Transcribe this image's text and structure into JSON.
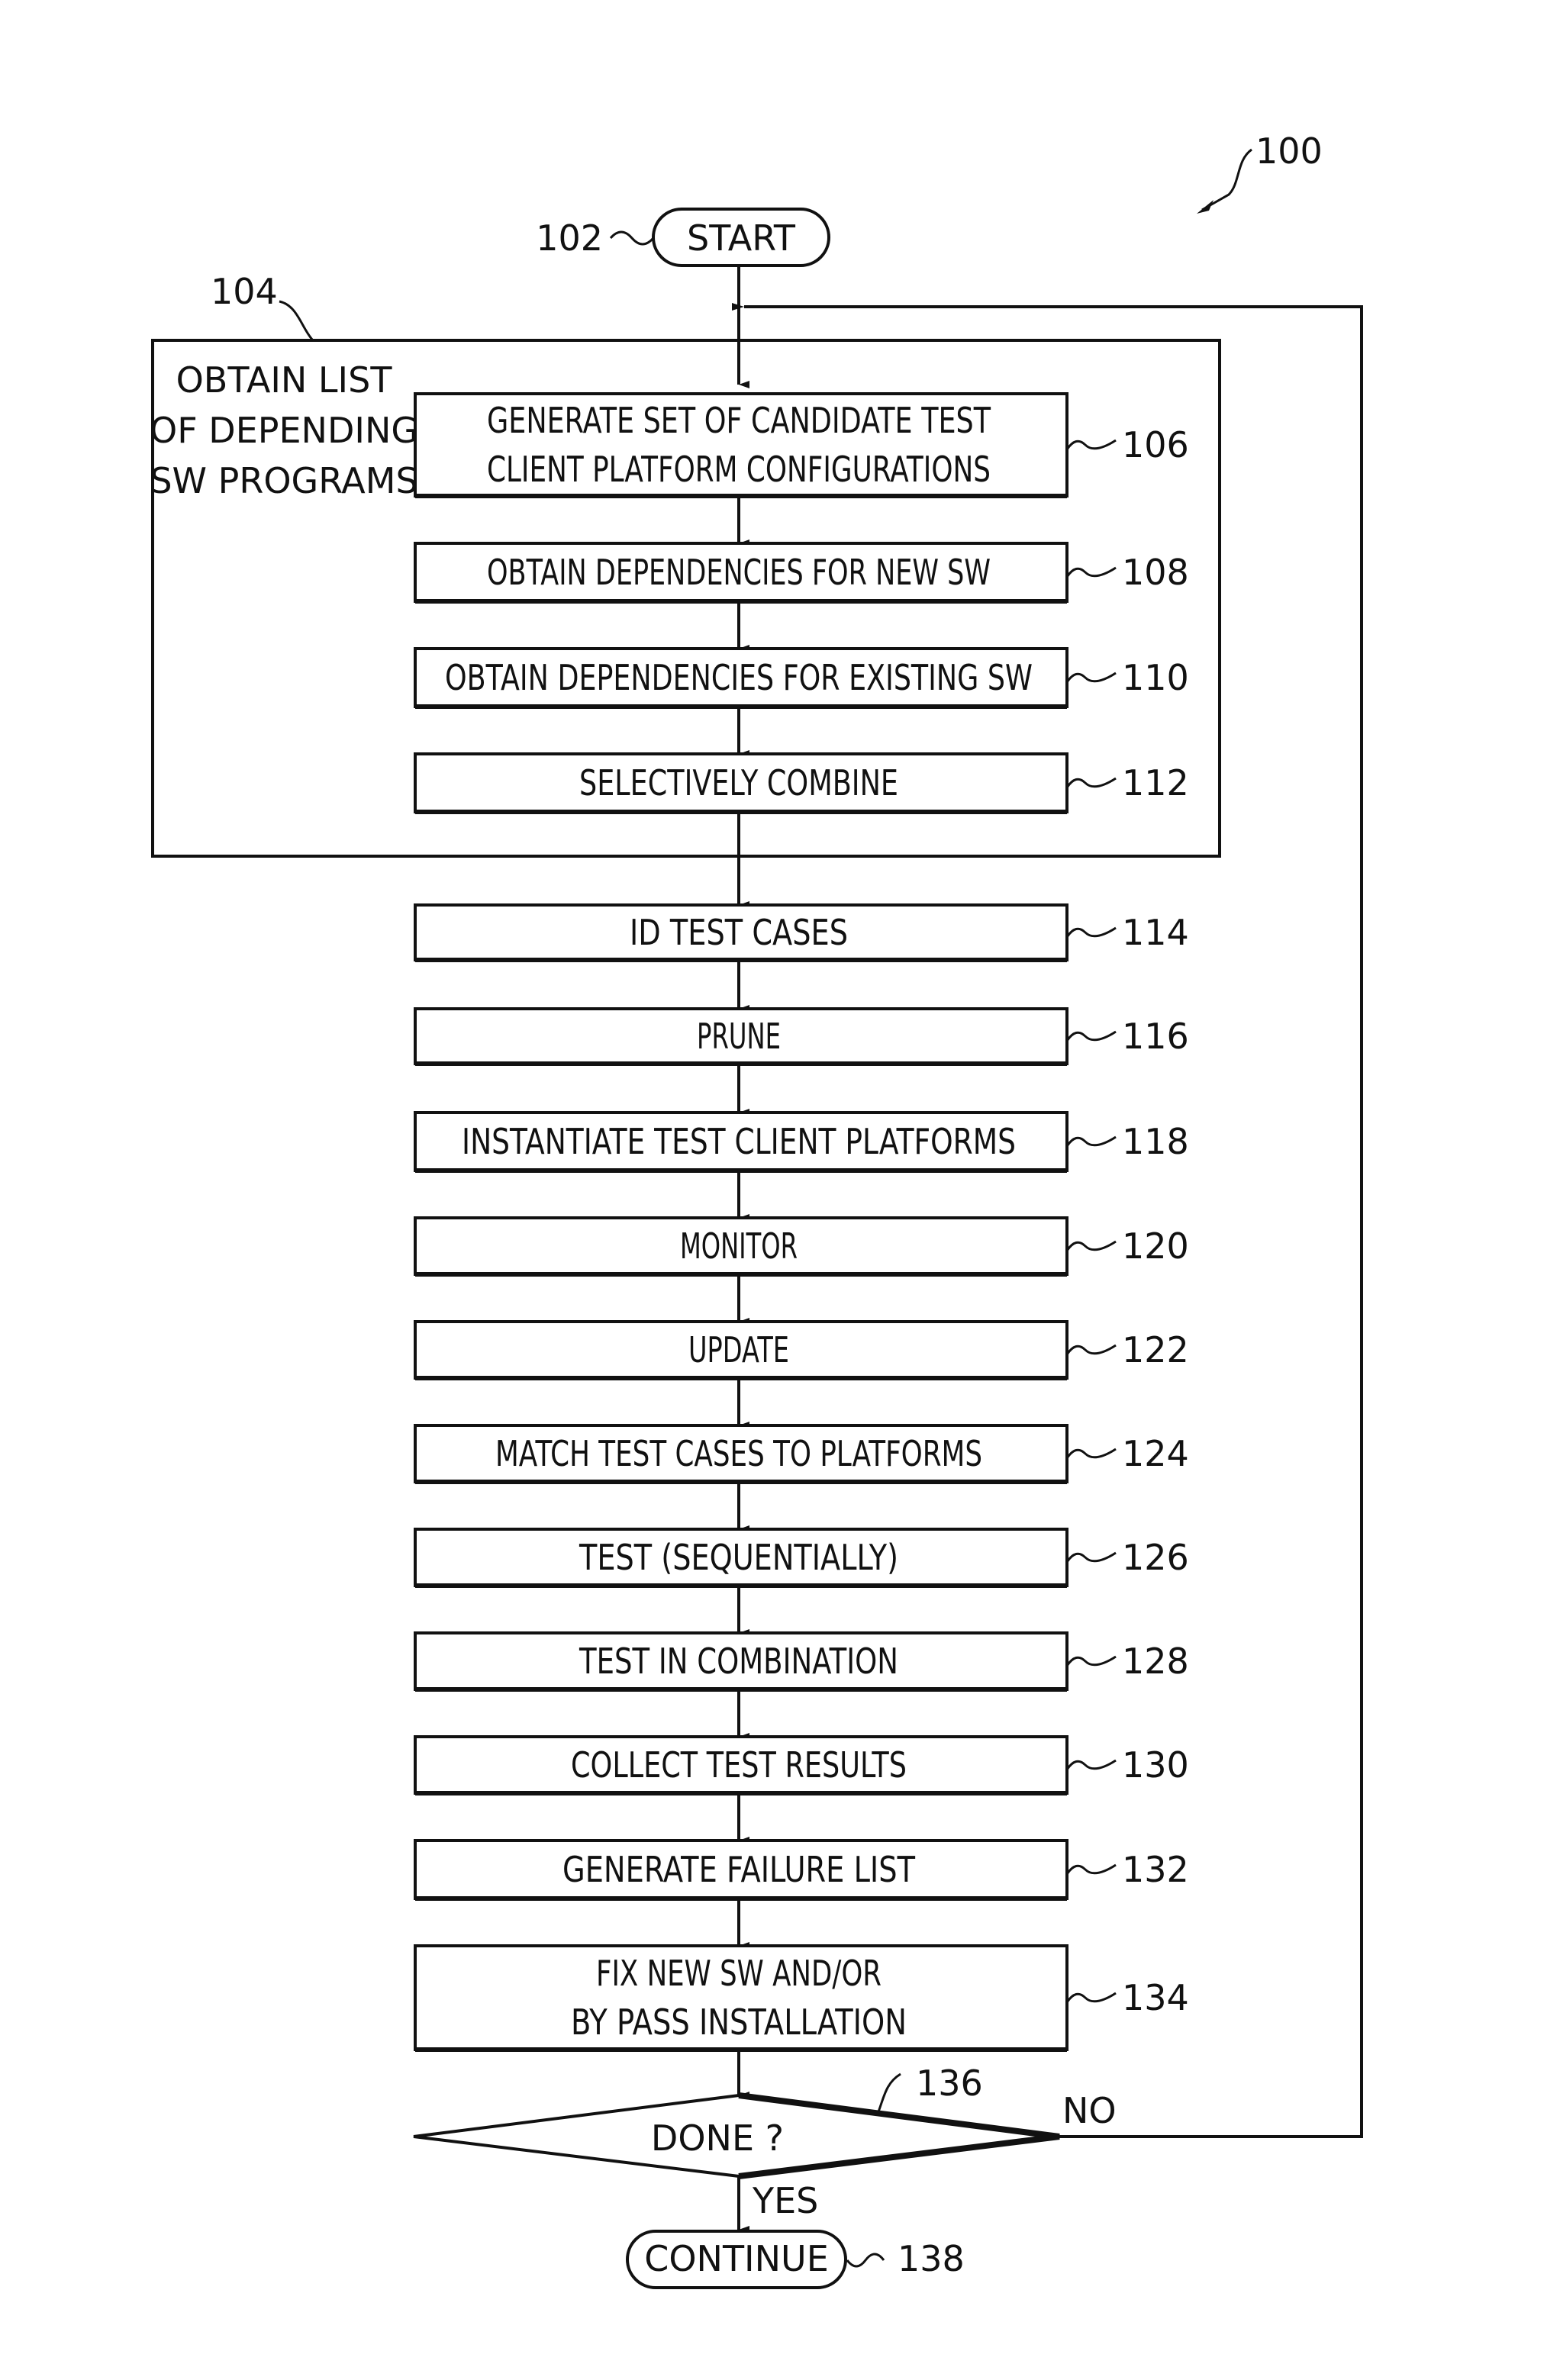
{
  "figure_ref": "100",
  "start": {
    "ref": "102",
    "label": "START"
  },
  "group": {
    "ref": "104",
    "label_lines": [
      "OBTAIN LIST",
      "OF DEPENDING",
      "SW PROGRAMS"
    ]
  },
  "steps": [
    {
      "ref": "106",
      "lines": [
        "GENERATE SET OF CANDIDATE TEST",
        "CLIENT PLATFORM CONFIGURATIONS"
      ]
    },
    {
      "ref": "108",
      "lines": [
        "OBTAIN DEPENDENCIES FOR NEW SW"
      ]
    },
    {
      "ref": "110",
      "lines": [
        "OBTAIN DEPENDENCIES FOR EXISTING SW"
      ]
    },
    {
      "ref": "112",
      "lines": [
        "SELECTIVELY COMBINE"
      ]
    },
    {
      "ref": "114",
      "lines": [
        "ID TEST CASES"
      ]
    },
    {
      "ref": "116",
      "lines": [
        "PRUNE"
      ]
    },
    {
      "ref": "118",
      "lines": [
        "INSTANTIATE TEST CLIENT PLATFORMS"
      ]
    },
    {
      "ref": "120",
      "lines": [
        "MONITOR"
      ]
    },
    {
      "ref": "122",
      "lines": [
        "UPDATE"
      ]
    },
    {
      "ref": "124",
      "lines": [
        "MATCH TEST CASES TO PLATFORMS"
      ]
    },
    {
      "ref": "126",
      "lines": [
        "TEST (SEQUENTIALLY)"
      ]
    },
    {
      "ref": "128",
      "lines": [
        "TEST IN COMBINATION"
      ]
    },
    {
      "ref": "130",
      "lines": [
        "COLLECT TEST RESULTS"
      ]
    },
    {
      "ref": "132",
      "lines": [
        "GENERATE FAILURE LIST"
      ]
    },
    {
      "ref": "134",
      "lines": [
        "FIX NEW SW AND/OR",
        "BY PASS INSTALLATION"
      ]
    }
  ],
  "decision": {
    "ref": "136",
    "label": "DONE ?",
    "yes": "YES",
    "no": "NO"
  },
  "end": {
    "ref": "138",
    "label": "CONTINUE"
  }
}
